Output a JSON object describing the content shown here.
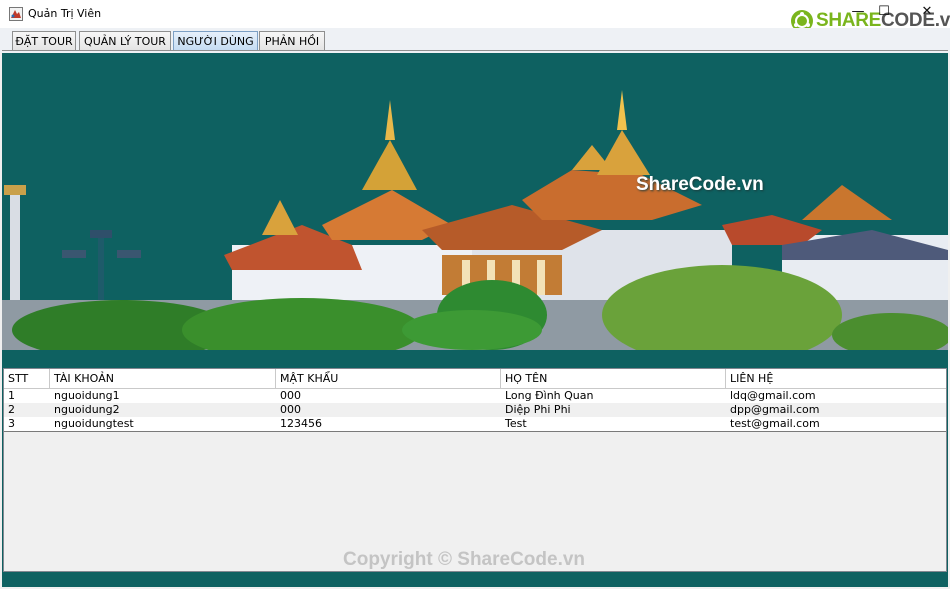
{
  "window": {
    "title": "Quản Trị Viên",
    "controls": {
      "minimize": "—",
      "maximize": "☐",
      "close": "✕"
    }
  },
  "watermark": {
    "logo_part1": "SHARE",
    "logo_part2": "CODE.vn",
    "banner_text": "ShareCode.vn",
    "footer_text": "Copyright © ShareCode.vn"
  },
  "tabs": [
    {
      "label": "ĐẶT TOUR",
      "active": false
    },
    {
      "label": "QUẢN LÝ TOUR",
      "active": false
    },
    {
      "label": "NGƯỜI DÙNG",
      "active": true
    },
    {
      "label": "PHẢN HỒI",
      "active": false
    }
  ],
  "table": {
    "columns": [
      "STT",
      "TÀI KHOẢN",
      "MẬT KHẨU",
      "HỌ TÊN",
      "LIÊN HỆ"
    ],
    "rows": [
      [
        "1",
        "nguoidung1",
        "000",
        "Long Đình Quan",
        "ldq@gmail.com"
      ],
      [
        "2",
        "nguoidung2",
        "000",
        "Diệp Phi Phi",
        "dpp@gmail.com"
      ],
      [
        "3",
        "nguoidungtest",
        "123456",
        "Test",
        "test@gmail.com"
      ]
    ]
  },
  "colors": {
    "background": "#0e6161",
    "sky": "#0e6161",
    "logo_green": "#7ab51d",
    "active_tab": "#c5dcf3"
  }
}
